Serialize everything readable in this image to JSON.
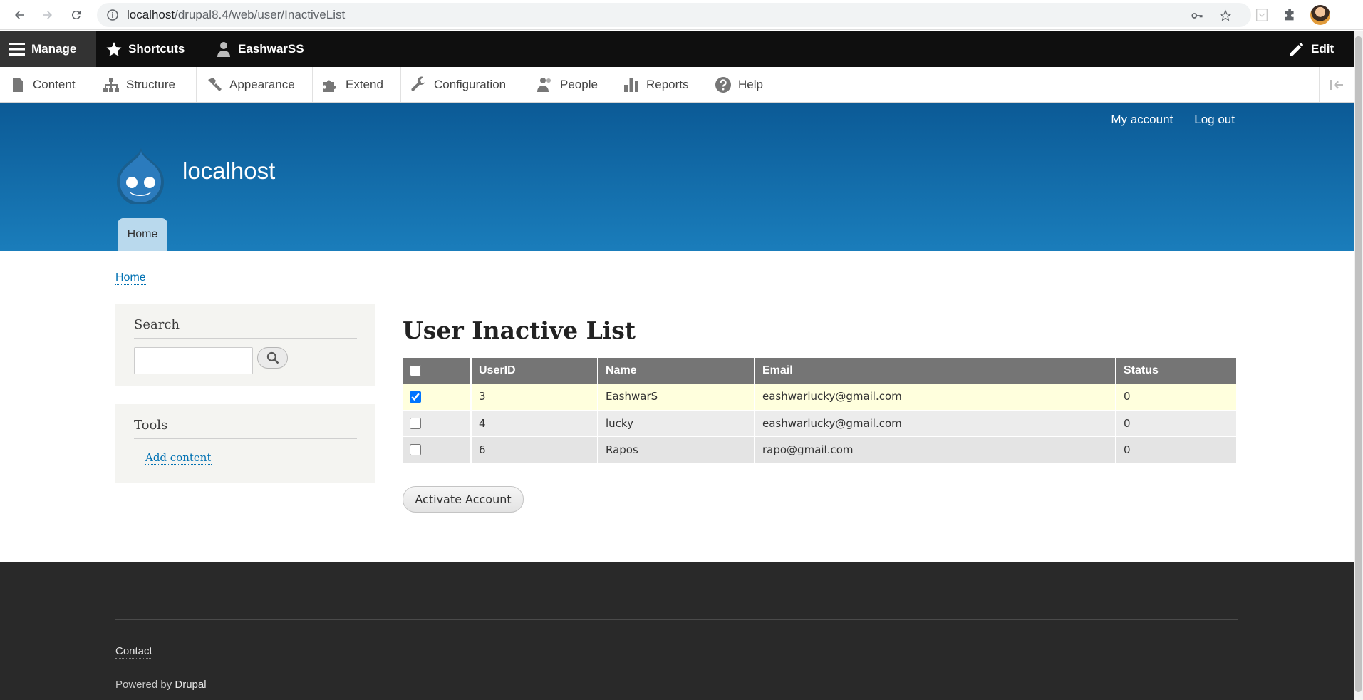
{
  "browser": {
    "url_host": "localhost",
    "url_path": "/drupal8.4/web/user/InactiveList"
  },
  "toolbar": {
    "manage_label": "Manage",
    "shortcuts_label": "Shortcuts",
    "user_label": "EashwarSS",
    "edit_label": "Edit",
    "tray_items": [
      {
        "label": "Content",
        "icon": "file-icon"
      },
      {
        "label": "Structure",
        "icon": "structure-icon"
      },
      {
        "label": "Appearance",
        "icon": "paintbrush-icon"
      },
      {
        "label": "Extend",
        "icon": "puzzle-icon"
      },
      {
        "label": "Configuration",
        "icon": "wrench-icon"
      },
      {
        "label": "People",
        "icon": "people-icon"
      },
      {
        "label": "Reports",
        "icon": "bar-chart-icon"
      },
      {
        "label": "Help",
        "icon": "help-icon"
      }
    ]
  },
  "header": {
    "my_account": "My account",
    "log_out": "Log out",
    "site_name": "localhost",
    "home_tab": "Home"
  },
  "breadcrumb": {
    "home": "Home"
  },
  "sidebar": {
    "search_title": "Search",
    "tools_title": "Tools",
    "add_content": "Add content"
  },
  "main": {
    "title": "User Inactive List",
    "columns": [
      "UserID",
      "Name",
      "Email",
      "Status"
    ],
    "rows": [
      {
        "checked": true,
        "userid": "3",
        "name": "EashwarS",
        "email": "eashwarlucky@gmail.com",
        "status": "0"
      },
      {
        "checked": false,
        "userid": "4",
        "name": "lucky",
        "email": "eashwarlucky@gmail.com",
        "status": "0"
      },
      {
        "checked": false,
        "userid": "6",
        "name": "Rapos",
        "email": "rapo@gmail.com",
        "status": "0"
      }
    ],
    "activate_button": "Activate Account"
  },
  "footer": {
    "contact": "Contact",
    "powered_by": "Powered by",
    "drupal": "Drupal"
  }
}
